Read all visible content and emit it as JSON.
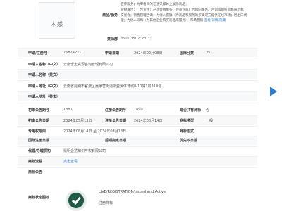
{
  "logo": {
    "text": "木感"
  },
  "goods": {
    "label": "商品/服务",
    "lines": [
      "宣传服务；为零售目的在通讯媒体上展示商品；",
      "货物展出；广告宣传；产品营销服务；为商业或广告目的举办、咨询和组织贸易展示和",
      "交易会；销售管理咨询；为他人撰稿（为商品和服务的买卖双方提供在线市场；进出口代",
      "理；为他人采购（为其他企业购买商品或服务）；市场营销"
    ],
    "more": "查看/详情/隐藏"
  },
  "group": {
    "label": "类似群",
    "value": "3501;3502;3503;"
  },
  "rows": [
    {
      "a_label": "申请/注册号",
      "a_value": "76824271",
      "b_label": "申请日期",
      "b_value": "2024年02月08日",
      "c_label": "国际分类",
      "c_value": "35"
    },
    {
      "a_label": "申请人名称（中文）",
      "a_value": "云南乐土资源咨询管理有限公司"
    },
    {
      "a_label": "申请人名称（英文）",
      "a_value": ""
    },
    {
      "a_label": "申请人地址（中文）",
      "a_value": "云南省昆明市官渡区吴家营街道新亚洲体育城8-10幢1层310号"
    },
    {
      "a_label": "申请人地址（英文）",
      "a_value": ""
    },
    {
      "a_label": "初审公告期号",
      "a_value": "1887",
      "b_label": "注册公告期号",
      "b_value": "1899",
      "c_label": "是否共有商标",
      "c_value": "否"
    },
    {
      "a_label": "初审公告日期",
      "a_value": "2024年05月13日",
      "b_label": "注册公告日期",
      "b_value": "2024年08月14日",
      "c_label": "商标类型",
      "c_value": "一般"
    },
    {
      "a_label": "专用权期限",
      "a_value": "2024年08月14日 至 2034年08月13日",
      "b_label": "",
      "b_value": "",
      "c_label": "商标形式",
      "c_value": ""
    },
    {
      "a_label": "国际注册日期",
      "a_value": "",
      "b_label": "后期指定日期",
      "b_value": "",
      "c_label": "优先权日期",
      "c_value": ""
    },
    {
      "a_label": "代理/办理机构",
      "a_value": "昆明企慧知识产权有限公司"
    },
    {
      "a_label": "商标流程",
      "a_value": "点击查看",
      "link": true
    },
    {
      "a_label": "商标公告",
      "a_value": ""
    }
  ],
  "status": {
    "label": "商标状态图标",
    "english": "LIVE/REGISTRATION/Issued and Active",
    "chinese": "注册商标",
    "color": "#1f5a46"
  },
  "nav": {
    "icon": "arrow-right-icon",
    "color": "#2f7dd1"
  }
}
